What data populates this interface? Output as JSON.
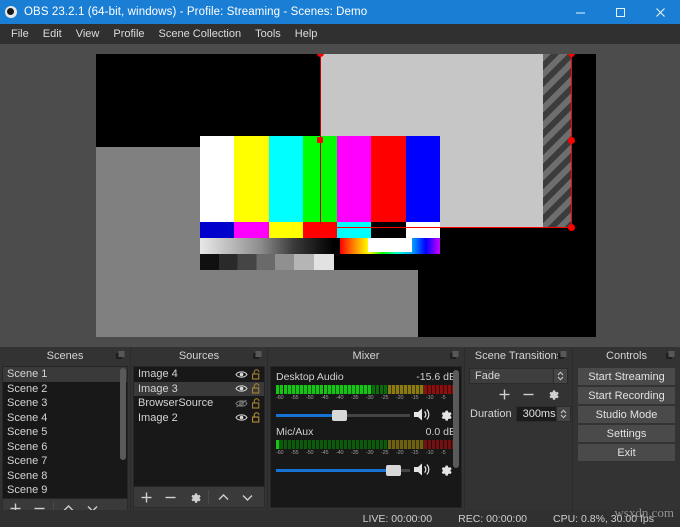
{
  "window": {
    "title": "OBS 23.2.1 (64-bit, windows) - Profile: Streaming - Scenes: Demo",
    "app_icon": "obs-logo-icon",
    "minimize_label": "–",
    "maximize_label": "☐",
    "close_label": "✕",
    "titlebar_color": "#1a7fd4"
  },
  "menu": {
    "items": [
      {
        "label": "File"
      },
      {
        "label": "Edit"
      },
      {
        "label": "View"
      },
      {
        "label": "Profile"
      },
      {
        "label": "Scene Collection"
      },
      {
        "label": "Tools"
      },
      {
        "label": "Help"
      }
    ]
  },
  "preview": {
    "selection_color": "#ff0000",
    "color_bars": {
      "main": [
        "#ffffff",
        "#ffff00",
        "#00ffff",
        "#00ff00",
        "#ff00ff",
        "#ff0000",
        "#0000ff"
      ],
      "secondary": [
        "#0000cc",
        "#ff00ff",
        "#ffff00",
        "#ff0000",
        "#00ffff",
        "#000000",
        "#ffffff"
      ]
    }
  },
  "scenes": {
    "title": "Scenes",
    "items": [
      {
        "label": "Scene 1",
        "selected": true
      },
      {
        "label": "Scene 2",
        "selected": false
      },
      {
        "label": "Scene 3",
        "selected": false
      },
      {
        "label": "Scene 4",
        "selected": false
      },
      {
        "label": "Scene 5",
        "selected": false
      },
      {
        "label": "Scene 6",
        "selected": false
      },
      {
        "label": "Scene 7",
        "selected": false
      },
      {
        "label": "Scene 8",
        "selected": false
      },
      {
        "label": "Scene 9",
        "selected": false
      }
    ],
    "toolbar": {
      "add": "+",
      "remove": "–",
      "move_up": "∧",
      "move_down": "∨"
    }
  },
  "sources": {
    "title": "Sources",
    "items": [
      {
        "label": "Image 4",
        "visible": true,
        "locked": false,
        "selected": false
      },
      {
        "label": "Image 3",
        "visible": true,
        "locked": false,
        "selected": true
      },
      {
        "label": "BrowserSource",
        "visible": false,
        "locked": false,
        "selected": false
      },
      {
        "label": "Image 2",
        "visible": true,
        "locked": false,
        "selected": false
      }
    ],
    "toolbar": {
      "add": "+",
      "remove": "–",
      "properties": "gear",
      "move_up": "∧",
      "move_down": "∨"
    }
  },
  "mixer": {
    "title": "Mixer",
    "tracks": [
      {
        "name": "Desktop Audio",
        "level": "-15.6 dB",
        "volume_percent": 45,
        "meter_percent": 71
      },
      {
        "name": "Mic/Aux",
        "level": "0.0 dB",
        "volume_percent": 85,
        "meter_percent": 2
      }
    ],
    "scale_ticks": [
      "-60",
      "-55",
      "-50",
      "-45",
      "-40",
      "-35",
      "-30",
      "-25",
      "-20",
      "-15",
      "-10",
      "-5",
      "0"
    ]
  },
  "transitions": {
    "title": "Scene Transitions",
    "selected_transition": "Fade",
    "add": "+",
    "remove": "–",
    "properties": "gear",
    "duration_label": "Duration",
    "duration_value": "300ms"
  },
  "controls": {
    "title": "Controls",
    "buttons": [
      {
        "label": "Start Streaming"
      },
      {
        "label": "Start Recording"
      },
      {
        "label": "Studio Mode"
      },
      {
        "label": "Settings"
      },
      {
        "label": "Exit"
      }
    ]
  },
  "status": {
    "live": "LIVE: 00:00:00",
    "rec": "REC: 00:00:00",
    "cpu": "CPU: 0.8%, 30.00 fps"
  },
  "watermark": "wsxdn.com"
}
